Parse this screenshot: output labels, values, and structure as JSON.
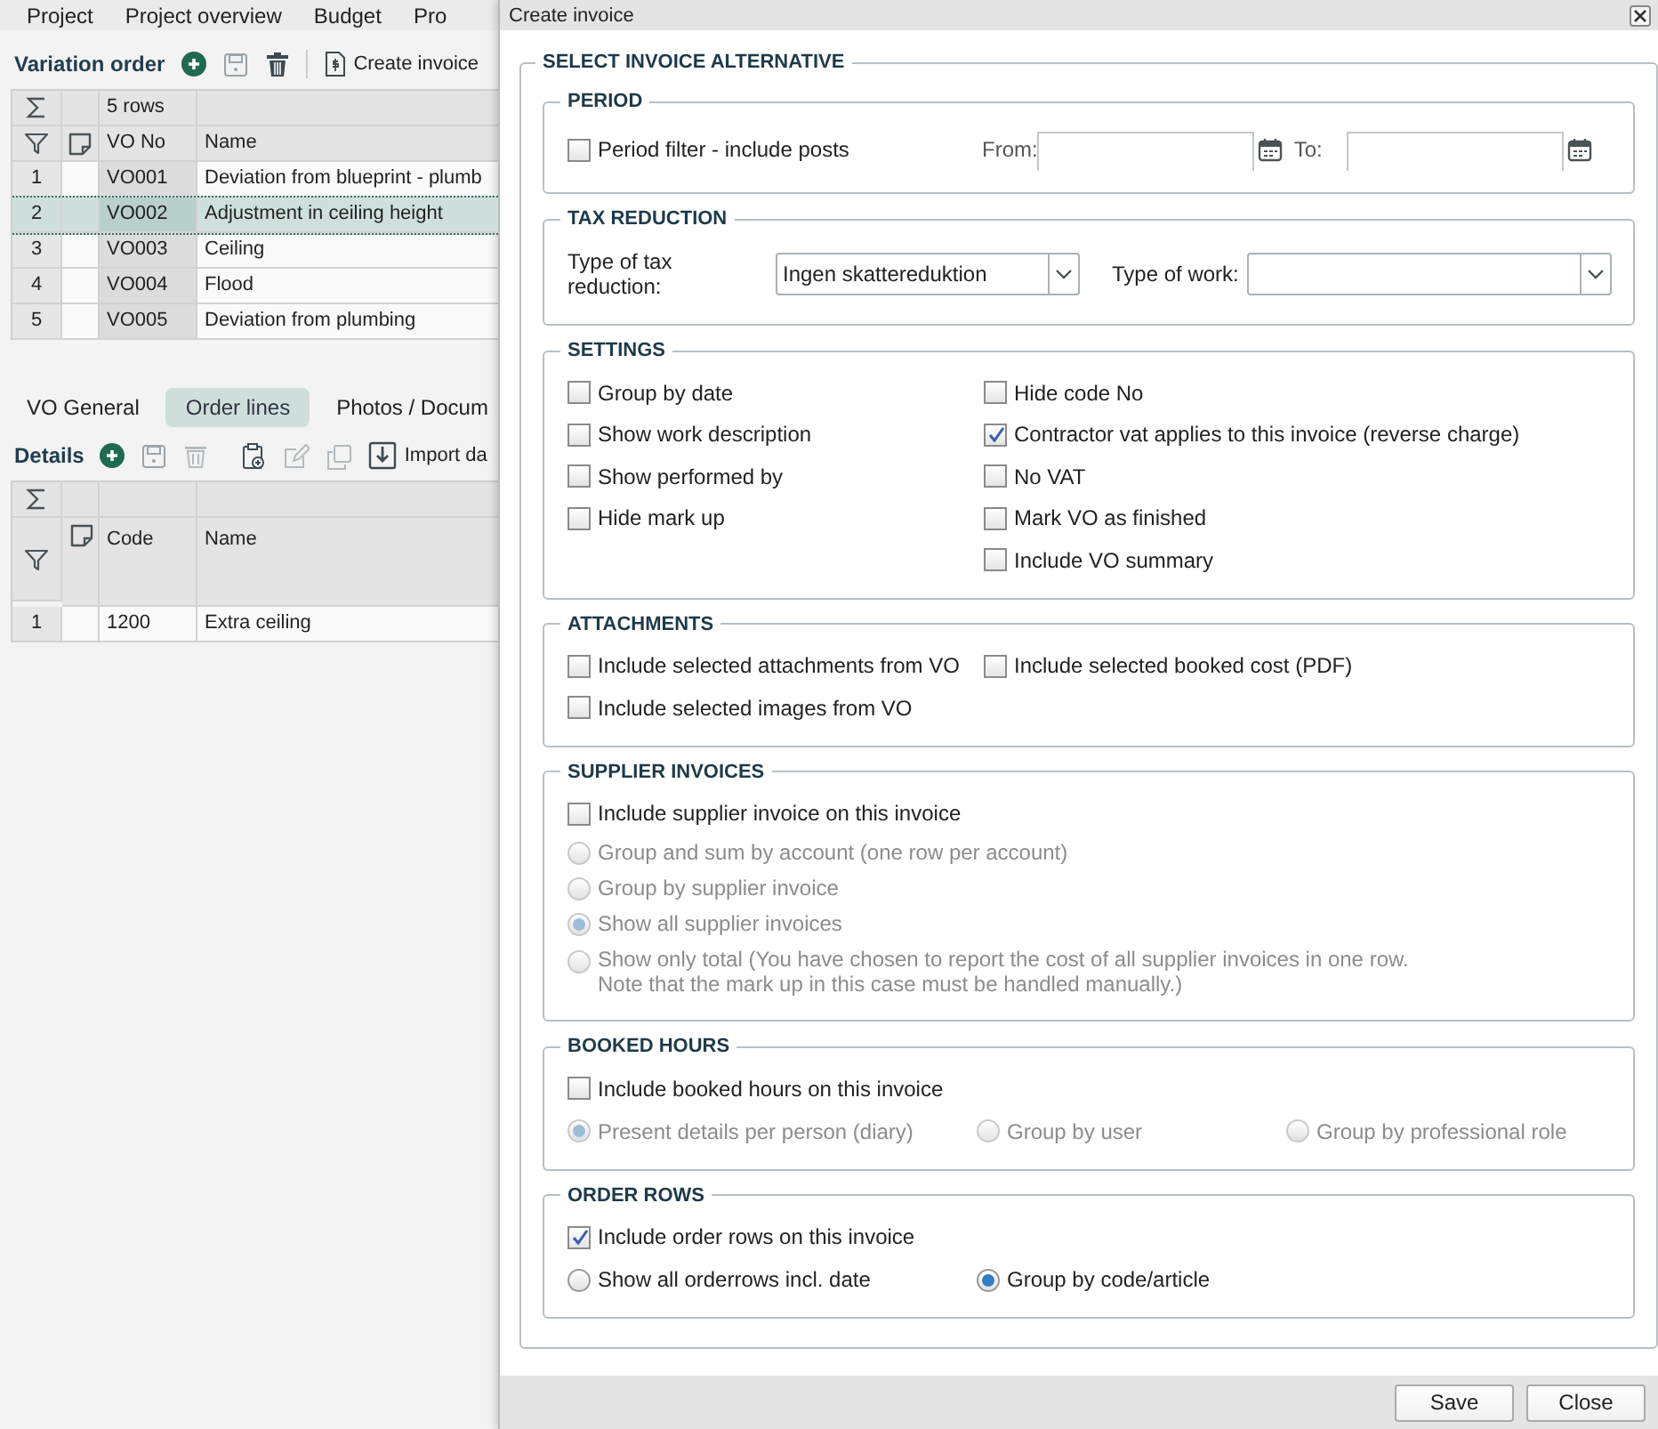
{
  "app": {
    "nav_tabs": [
      "Project",
      "Project overview",
      "Budget",
      "Pro"
    ],
    "variation_order": {
      "title": "Variation order",
      "create_button": "Create invoice",
      "row_count": "5 rows",
      "columns": [
        "VO No",
        "Name"
      ],
      "rows": [
        {
          "number": "1",
          "vo_no": "VO001",
          "name": "Deviation from blueprint - plumb",
          "selected": false
        },
        {
          "number": "2",
          "vo_no": "VO002",
          "name": "Adjustment in ceiling height",
          "selected": true
        },
        {
          "number": "3",
          "vo_no": "VO003",
          "name": "Ceiling",
          "selected": false
        },
        {
          "number": "4",
          "vo_no": "VO004",
          "name": "Flood",
          "selected": false
        },
        {
          "number": "5",
          "vo_no": "VO005",
          "name": "Deviation from plumbing",
          "selected": false
        }
      ]
    },
    "detail_tabs": [
      {
        "label": "VO General",
        "selected": false
      },
      {
        "label": "Order lines",
        "selected": true
      },
      {
        "label": "Photos / Docum",
        "selected": false
      }
    ],
    "details": {
      "title": "Details",
      "import_button": "Import da",
      "columns": [
        "Code",
        "Name"
      ],
      "rows": [
        {
          "number": "1",
          "code": "1200",
          "name": "Extra ceiling"
        }
      ]
    }
  },
  "dialog": {
    "title": "Create invoice",
    "group_title": "SELECT INVOICE ALTERNATIVE",
    "sections": [
      {
        "title": "PERIOD",
        "kind": "period",
        "filter": {
          "label": "Period filter - include posts",
          "checked": false
        },
        "from": {
          "label": "From:"
        },
        "to": {
          "label": "To:"
        }
      },
      {
        "title": "TAX REDUCTION",
        "kind": "tax",
        "tax_type": {
          "label": "Type of tax reduction:",
          "value": "Ingen skattereduktion"
        },
        "work_type": {
          "label": "Type of work:"
        }
      },
      {
        "title": "SETTINGS",
        "kind": "columns",
        "columns": [
          [
            {
              "kind": "checkbox",
              "label": "Group by date",
              "checked": false
            },
            {
              "kind": "checkbox",
              "label": "Show work description",
              "checked": false
            },
            {
              "kind": "checkbox",
              "label": "Show performed by",
              "checked": false
            },
            {
              "kind": "checkbox",
              "label": "Hide mark up",
              "checked": false
            }
          ],
          [
            {
              "kind": "checkbox",
              "label": "Hide code No",
              "checked": false
            },
            {
              "kind": "checkbox",
              "label": "Contractor vat applies to this invoice (reverse charge)",
              "checked": true
            },
            {
              "kind": "checkbox",
              "label": "No VAT",
              "checked": false
            },
            {
              "kind": "checkbox",
              "label": "Mark VO as finished",
              "checked": false
            },
            {
              "kind": "checkbox",
              "label": "Include VO summary",
              "checked": false
            }
          ]
        ]
      },
      {
        "title": "ATTACHMENTS",
        "kind": "columns",
        "columns": [
          [
            {
              "kind": "checkbox",
              "label": "Include selected attachments from VO",
              "checked": false
            },
            {
              "kind": "checkbox",
              "label": "Include selected images from VO",
              "checked": false
            }
          ],
          [
            {
              "kind": "checkbox",
              "label": "Include selected booked cost (PDF)",
              "checked": false
            }
          ]
        ]
      },
      {
        "title": "SUPPLIER INVOICES",
        "kind": "list",
        "items": [
          {
            "kind": "checkbox",
            "label": "Include supplier invoice on this invoice",
            "checked": false
          },
          {
            "kind": "radio",
            "label": "Group and sum by account (one row per account)",
            "selected": false,
            "disabled": true
          },
          {
            "kind": "radio",
            "label": "Group by supplier invoice",
            "selected": false,
            "disabled": true
          },
          {
            "kind": "radio",
            "label": "Show all supplier invoices",
            "selected": true,
            "disabled": true
          },
          {
            "kind": "radio",
            "label": "Show only total (You have chosen to report the cost of all supplier invoices in one row.\nNote that the mark up in this case must be handled manually.)",
            "selected": false,
            "disabled": true
          }
        ]
      },
      {
        "title": "BOOKED HOURS",
        "kind": "list",
        "items": [
          {
            "kind": "checkbox",
            "label": "Include booked hours on this invoice",
            "checked": false
          }
        ],
        "options": [
          {
            "kind": "radio",
            "label": "Present details per person (diary)",
            "selected": true,
            "disabled": true
          },
          {
            "kind": "radio",
            "label": "Group by user",
            "selected": false,
            "disabled": true
          },
          {
            "kind": "radio",
            "label": "Group by professional role",
            "selected": false,
            "disabled": true
          }
        ]
      },
      {
        "title": "ORDER ROWS",
        "kind": "list",
        "items": [
          {
            "kind": "checkbox",
            "label": "Include order rows on this invoice",
            "checked": true
          }
        ],
        "options": [
          {
            "kind": "radio",
            "label": "Show all orderrows incl. date",
            "selected": false,
            "disabled": false
          },
          {
            "kind": "radio",
            "label": "Group by code/article",
            "selected": true,
            "disabled": false
          }
        ]
      }
    ],
    "buttons": [
      "Save",
      "Close"
    ]
  }
}
